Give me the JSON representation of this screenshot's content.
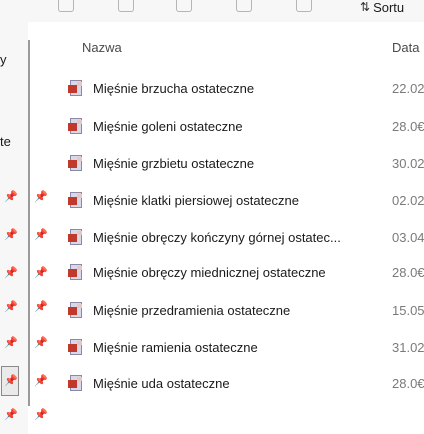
{
  "toolbar": {
    "sort_label": "Sortu",
    "icons": [
      "copy-icon",
      "paste-icon",
      "rename-icon",
      "share-icon",
      "delete-icon"
    ]
  },
  "nav": {
    "partial_items": [
      "y",
      "te"
    ]
  },
  "columns": {
    "name": "Nazwa",
    "date": "Data"
  },
  "files": [
    {
      "name": "Mięśnie brzucha ostateczne",
      "date": "22.02"
    },
    {
      "name": "Mięśnie goleni ostateczne",
      "date": "28.0€"
    },
    {
      "name": "Mięśnie grzbietu ostateczne",
      "date": "30.02"
    },
    {
      "name": "Mięśnie klatki piersiowej ostateczne",
      "date": "02.02"
    },
    {
      "name": "Mięśnie obręczy kończyny górnej ostatec...",
      "date": "03.04"
    },
    {
      "name": "Mięśnie obręczy miednicznej ostateczne",
      "date": "28.0€"
    },
    {
      "name": "Mięśnie przedramienia ostateczne",
      "date": "15.05"
    },
    {
      "name": "Mięśnie ramienia ostateczne",
      "date": "31.02"
    },
    {
      "name": "Mięśnie uda ostateczne",
      "date": "28.0€"
    }
  ]
}
